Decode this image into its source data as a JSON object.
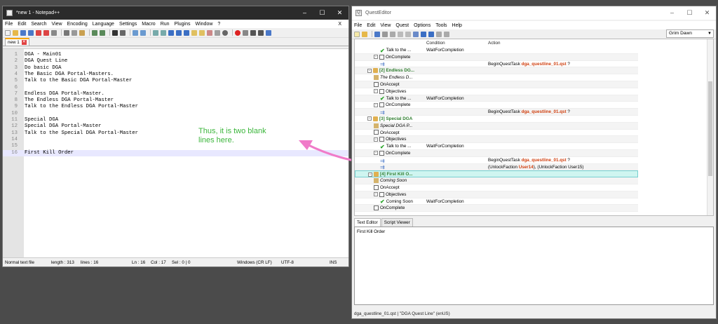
{
  "notepad": {
    "title": "*new 1 - Notepad++",
    "menu": [
      "File",
      "Edit",
      "Search",
      "View",
      "Encoding",
      "Language",
      "Settings",
      "Macro",
      "Run",
      "Plugins",
      "Window",
      "?"
    ],
    "close_x": "X",
    "tab": "new 1",
    "lines": [
      {
        "n": "1",
        "t": "DGA - Main01"
      },
      {
        "n": "2",
        "t": "DGA Quest Line"
      },
      {
        "n": "3",
        "t": "Do basic DGA"
      },
      {
        "n": "4",
        "t": "The Basic DGA Portal-Masters."
      },
      {
        "n": "5",
        "t": "Talk to the Basic DGA Portal-Master"
      },
      {
        "n": "6",
        "t": ""
      },
      {
        "n": "7",
        "t": "Endless DGA Portal-Master."
      },
      {
        "n": "8",
        "t": "The Endless DGA Portal-Master"
      },
      {
        "n": "9",
        "t": "Talk to the Endless DGA Portal-Master"
      },
      {
        "n": "10",
        "t": ""
      },
      {
        "n": "11",
        "t": "Special DGA"
      },
      {
        "n": "12",
        "t": "Special DGA Portal-Master"
      },
      {
        "n": "13",
        "t": "Talk to the Special DGA Portal-Master"
      },
      {
        "n": "14",
        "t": ""
      },
      {
        "n": "15",
        "t": ""
      },
      {
        "n": "16",
        "t": "First Kill Order"
      }
    ],
    "status": {
      "type": "Normal text file",
      "length": "length : 313",
      "lines": "lines : 16",
      "ln": "Ln : 16",
      "col": "Col : 17",
      "sel": "Sel : 0 | 0",
      "eol": "Windows (CR LF)",
      "enc": "UTF-8",
      "mode": "INS"
    }
  },
  "annotation": "Thus, it is two blank\nlines here.",
  "questeditor": {
    "title": "QuestEditor",
    "menu": [
      "File",
      "Edit",
      "View",
      "Quest",
      "Options",
      "Tools",
      "Help"
    ],
    "game_select": "Grim Dawn",
    "columns": {
      "condition": "Condition",
      "action": "Action"
    },
    "rows": [
      {
        "indent": 2,
        "icon": "check",
        "label": "Talk to the ...",
        "cond": "WaitForCompletion",
        "act": ""
      },
      {
        "indent": 1,
        "icon": "doc",
        "toggle": "-",
        "label": "OnComplete",
        "cond": "",
        "act": ""
      },
      {
        "indent": 2,
        "icon": "arrow",
        "label": "",
        "cond": "",
        "act": "BeginQuestTask ",
        "act_b": "dga_questline_01.qst",
        "act_t": " ?"
      },
      {
        "indent": 0,
        "icon": "scroll",
        "toggle": "-",
        "label": "[2] Endless DG...",
        "style": "boldg",
        "cond": "",
        "act": ""
      },
      {
        "indent": 1,
        "icon": "qi",
        "label": "The Endless D...",
        "style": "ital",
        "cond": "",
        "act": ""
      },
      {
        "indent": 1,
        "icon": "doc",
        "label": "OnAccept",
        "cond": "",
        "act": ""
      },
      {
        "indent": 1,
        "icon": "doc",
        "toggle": "-",
        "label": "Objectives",
        "cond": "",
        "act": ""
      },
      {
        "indent": 2,
        "icon": "check",
        "label": "Talk to the ...",
        "cond": "WaitForCompletion",
        "act": ""
      },
      {
        "indent": 1,
        "icon": "doc",
        "toggle": "-",
        "label": "OnComplete",
        "cond": "",
        "act": ""
      },
      {
        "indent": 2,
        "icon": "arrow",
        "label": "",
        "cond": "",
        "act": "BeginQuestTask ",
        "act_b": "dga_questline_01.qst",
        "act_t": " ?"
      },
      {
        "indent": 0,
        "icon": "scroll",
        "toggle": "-",
        "label": "[3] Special DGA",
        "style": "boldg",
        "cond": "",
        "act": ""
      },
      {
        "indent": 1,
        "icon": "qi",
        "label": "Special DGA P...",
        "style": "ital",
        "cond": "",
        "act": ""
      },
      {
        "indent": 1,
        "icon": "doc",
        "label": "OnAccept",
        "cond": "",
        "act": ""
      },
      {
        "indent": 1,
        "icon": "doc",
        "toggle": "-",
        "label": "Objectives",
        "cond": "",
        "act": ""
      },
      {
        "indent": 2,
        "icon": "check",
        "label": "Talk to the ...",
        "cond": "WaitForCompletion",
        "act": ""
      },
      {
        "indent": 1,
        "icon": "doc",
        "toggle": "-",
        "label": "OnComplete",
        "cond": "",
        "act": ""
      },
      {
        "indent": 2,
        "icon": "arrow",
        "label": "",
        "cond": "",
        "act": "BeginQuestTask ",
        "act_b": "dga_questline_01.qst",
        "act_t": " ?"
      },
      {
        "indent": 2,
        "icon": "arrow",
        "label": "",
        "cond": "",
        "act": "(UnlockFaction ",
        "act_b": "User14",
        "act_t": "), (UnlockFaction User15)"
      },
      {
        "indent": 0,
        "icon": "scroll",
        "toggle": "-",
        "label": "[4] First Kill O...",
        "style": "boldg",
        "hl": true,
        "cond": "",
        "act": ""
      },
      {
        "indent": 1,
        "icon": "qi",
        "label": "Coming Soon",
        "style": "ital",
        "cond": "",
        "act": ""
      },
      {
        "indent": 1,
        "icon": "doc",
        "label": "OnAccept",
        "cond": "",
        "act": ""
      },
      {
        "indent": 1,
        "icon": "doc",
        "toggle": "-",
        "label": "Objectives",
        "cond": "",
        "act": ""
      },
      {
        "indent": 2,
        "icon": "check",
        "label": "Coming Soon",
        "cond": "WaitForCompletion",
        "act": ""
      },
      {
        "indent": 1,
        "icon": "doc",
        "label": "OnComplete",
        "cond": "",
        "act": ""
      }
    ],
    "panel_tabs": [
      "Text Editor",
      "Script Viewer"
    ],
    "text_editor_value": "First Kill Order",
    "status": "dga_questline_01.qst | \"DGA Quest Line\" (enUS)"
  }
}
